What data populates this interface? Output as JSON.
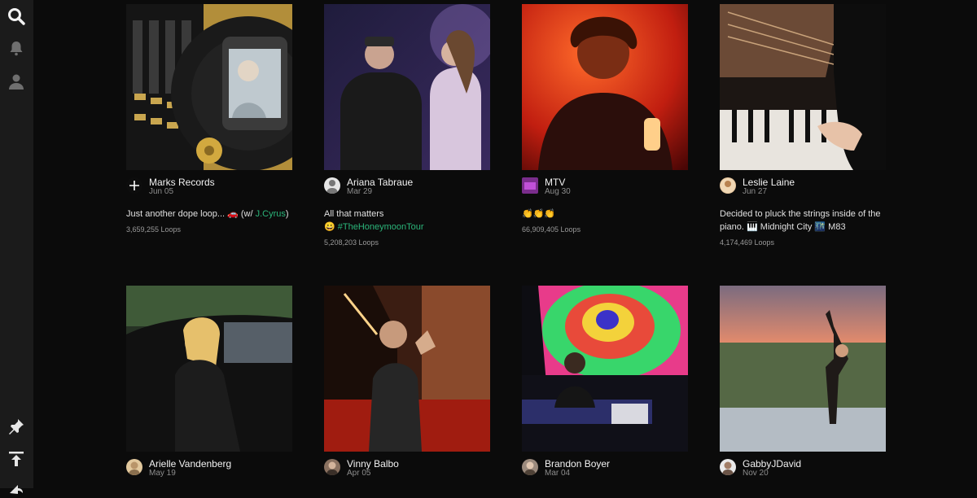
{
  "sidebar": {
    "top_icons": [
      "search-icon",
      "bell-icon",
      "profile-icon"
    ],
    "bottom_icons": [
      "pin-icon",
      "upload-icon",
      "share-icon"
    ]
  },
  "posts": [
    {
      "author": "Marks Records",
      "date": "Jun 05",
      "caption": "Just another dope loop... 🚗 (w/ ",
      "tag": "J.Cyrus",
      "caption_end": ")",
      "loops": "3,659,255 Loops"
    },
    {
      "author": "Ariana Tabraue",
      "date": "Mar 29",
      "caption": "All that matters",
      "tag": "😀 #TheHoneymoonTour",
      "caption_end": "",
      "loops": "5,208,203 Loops"
    },
    {
      "author": "MTV",
      "date": "Aug 30",
      "caption": "👏👏👏",
      "tag": "",
      "caption_end": "",
      "loops": "66,909,405 Loops"
    },
    {
      "author": "Leslie Laine",
      "date": "Jun 27",
      "caption": "Decided to pluck the strings inside of the piano. 🎹 Midnight City 🌃 M83",
      "tag": "",
      "caption_end": "",
      "loops": "4,174,469 Loops"
    },
    {
      "author": "Arielle Vandenberg",
      "date": "May 19"
    },
    {
      "author": "Vinny Balbo",
      "date": "Apr 05"
    },
    {
      "author": "Brandon Boyer",
      "date": "Mar 04"
    },
    {
      "author": "GabbyJDavid",
      "date": "Nov 20"
    }
  ]
}
